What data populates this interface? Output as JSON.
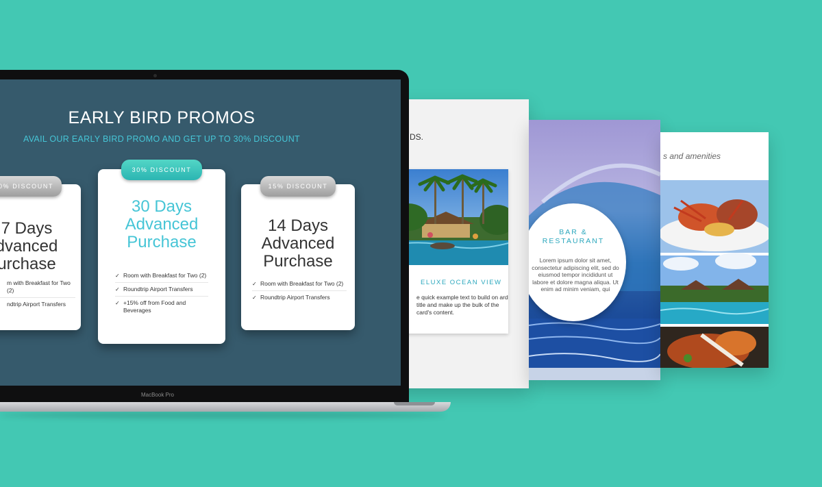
{
  "promo": {
    "title": "EARLY BIRD PROMOS",
    "subtitle": "AVAIL OUR EARLY BIRD PROMO AND GET UP TO 30% DISCOUNT",
    "cards": [
      {
        "badge": "0% DISCOUNT",
        "plan_lines": [
          "7 Days",
          "dvanced",
          "urchase"
        ],
        "features": [
          "m with Breakfast for Two (2)",
          "ndtrip Airport Transfers"
        ]
      },
      {
        "badge": "30% DISCOUNT",
        "plan_lines": [
          "30 Days",
          "Advanced",
          "Purchase"
        ],
        "features": [
          "Room with Breakfast for Two (2)",
          "Roundtrip Airport Transfers",
          "+15% off from Food and Beverages"
        ]
      },
      {
        "badge": "15% DISCOUNT",
        "plan_lines": [
          "14 Days",
          "Advanced",
          "Purchase"
        ],
        "features": [
          "Room with Breakfast for Two (2)",
          "Roundtrip Airport Transfers"
        ]
      }
    ]
  },
  "laptop": {
    "label": "MacBook Pro"
  },
  "panel1": {
    "header_text": "DS.",
    "card_title": "ELUXE OCEAN VIEW",
    "card_body": "e quick example text to build on ard title and make up the bulk of the card's content."
  },
  "panel2": {
    "circle_title_line1": "BAR &",
    "circle_title_line2": "RESTAURANT",
    "circle_body": "Lorem ipsum dolor sit amet, consectetur adipiscing elit, sed do eiusmod tempor incididunt ut labore et dolore magna aliqua. Ut enim ad minim veniam, qui"
  },
  "panel3": {
    "header_text": "s and amenities"
  },
  "colors": {
    "background": "#43c8b3",
    "screen": "#365a6c",
    "accent": "#46c5d6"
  }
}
